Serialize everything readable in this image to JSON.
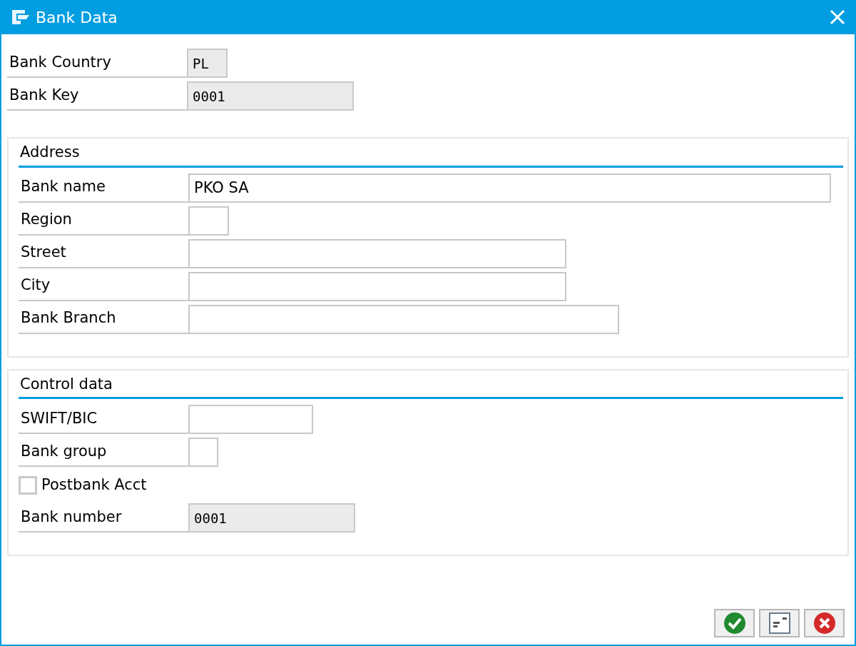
{
  "window": {
    "title": "Bank Data"
  },
  "header_fields": [
    {
      "kind": "field",
      "label": "Bank Country",
      "value": "PL",
      "readonly": true
    },
    {
      "kind": "field",
      "label": "Bank Key",
      "value": "0001",
      "readonly": true
    }
  ],
  "sections": [
    {
      "title": "Address",
      "fields": [
        {
          "kind": "field",
          "label": "Bank name",
          "value": "PKO SA",
          "readonly": false
        },
        {
          "kind": "field",
          "label": "Region",
          "readonly": false
        },
        {
          "kind": "field",
          "label": "Street",
          "readonly": false
        },
        {
          "kind": "field",
          "label": "City",
          "readonly": false
        },
        {
          "kind": "field",
          "label": "Bank Branch",
          "readonly": false
        }
      ]
    },
    {
      "title": "Control data",
      "fields": [
        {
          "kind": "field",
          "label": "SWIFT/BIC",
          "readonly": false
        },
        {
          "kind": "field",
          "label": "Bank group",
          "readonly": false
        },
        {
          "kind": "checkbox",
          "label": "Postbank Acct",
          "checked": false
        },
        {
          "kind": "field",
          "label": "Bank number",
          "value": "0001",
          "readonly": true
        }
      ]
    }
  ],
  "buttons": [
    {
      "kind": "confirm"
    },
    {
      "kind": "details"
    },
    {
      "kind": "cancel"
    }
  ]
}
